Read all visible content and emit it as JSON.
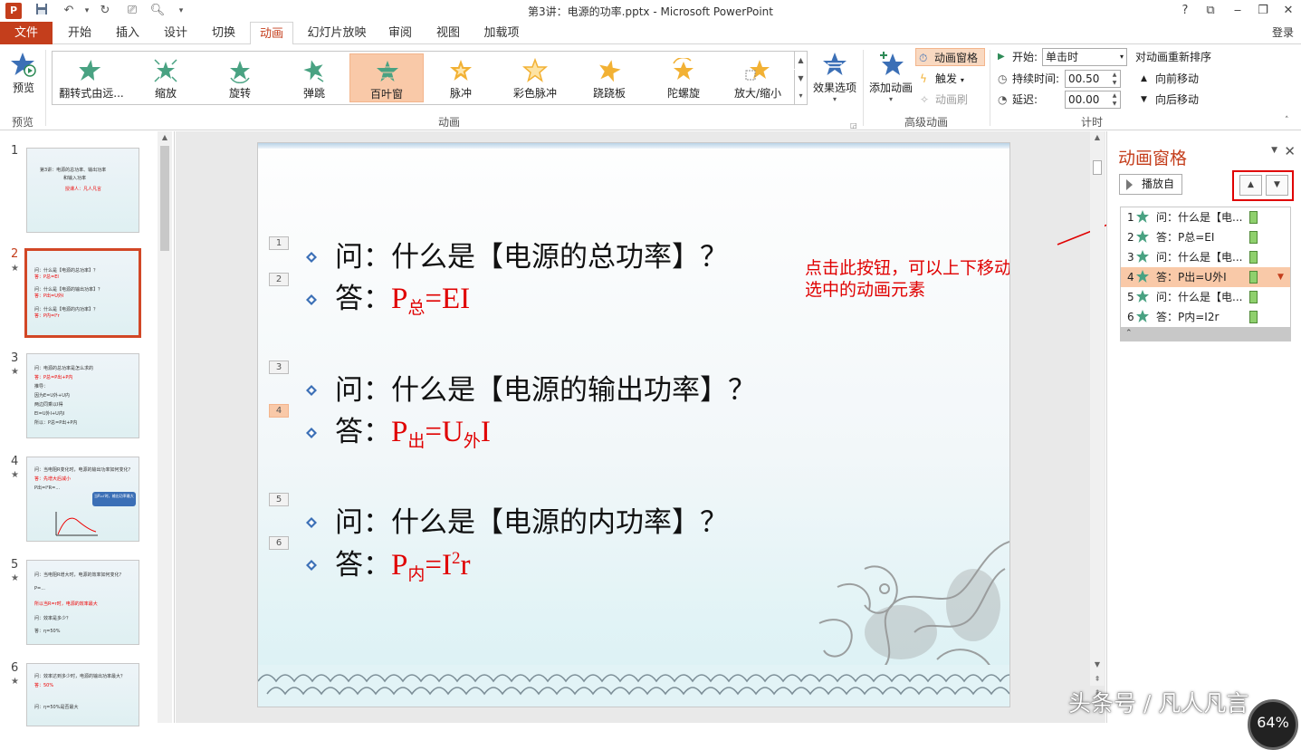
{
  "window": {
    "title": "第3讲：电源的功率.pptx - Microsoft PowerPoint",
    "help": "?",
    "signin": "登录"
  },
  "tabs": [
    "文件",
    "开始",
    "插入",
    "设计",
    "切换",
    "动画",
    "幻灯片放映",
    "审阅",
    "视图",
    "加载项"
  ],
  "active_tab": "动画",
  "ribbon": {
    "preview_label": "预览",
    "preview_group": "预览",
    "gallery": [
      "翻转式由远...",
      "缩放",
      "旋转",
      "弹跳",
      "百叶窗",
      "脉冲",
      "彩色脉冲",
      "跷跷板",
      "陀螺旋",
      "放大/缩小"
    ],
    "gallery_selected": "百叶窗",
    "effect_options": "效果选项",
    "animation_group": "动画",
    "add_animation": "添加动画",
    "animation_pane_btn": "动画窗格",
    "trigger": "触发",
    "painter": "动画刷",
    "advanced_group": "高级动画",
    "start_label": "开始:",
    "start_value": "单击时",
    "duration_label": "持续时间:",
    "duration_value": "00.50",
    "delay_label": "延迟:",
    "delay_value": "00.00",
    "timing_group": "计时",
    "reorder_title": "对动画重新排序",
    "move_earlier": "向前移动",
    "move_later": "向后移动"
  },
  "thumbnails": {
    "numbers": [
      "1",
      "2",
      "3",
      "4",
      "5",
      "6"
    ],
    "selected": "2",
    "slide1": {
      "title": "第3讲：电源的总功率、输出功率",
      "title2": "和输入功率",
      "sub": "授课人：凡人凡言"
    },
    "slide2": [
      "问：什么是【电源的总功率】？",
      "答：P总=EI",
      "问：什么是【电源的输出功率】？",
      "答：P出=U外I",
      "问：什么是【电源的内功率】？",
      "答：P内=I²r"
    ],
    "slide3": [
      "问：电源的总功率是怎么求的",
      "答：P总=P出+P内",
      "推导：",
      "因为E=U外+U内",
      "两边同乘以I得",
      "EI=U外I+U内I",
      "所以：P总=P出+P内"
    ],
    "slide4": [
      "问：当电阻R变化时，电源的输出功率如何变化？",
      "答：先增大后减小",
      "P出=I²R=...",
      "当R=r时，输出功率最大"
    ],
    "slide5": [
      "问：当电阻R增大时，电源的效率如何变化？",
      "P=...",
      "所以当R=r时，电源的效率最大",
      "问：效率是多少？",
      "答：η=50%"
    ],
    "slide6": [
      "问：效率达到多少时，电源的输出功率最大？",
      "答：50%",
      "问：η=50%是否最大"
    ]
  },
  "slide": {
    "tags": [
      "1",
      "2",
      "3",
      "4",
      "5",
      "6"
    ],
    "selected_tag": "4",
    "q1": "问：什么是【电源的总功率】？",
    "a1_prefix": "答：",
    "a1_p": "P",
    "a1_sub": "总",
    "a1_rest": "=EI",
    "q2": "问：什么是【电源的输出功率】？",
    "a2_prefix": "答：",
    "a2_p": "P",
    "a2_sub": "出",
    "a2_mid": "=U",
    "a2_sub2": "外",
    "a2_rest": "I",
    "q3": "问：什么是【电源的内功率】？",
    "a3_prefix": "答：",
    "a3_p": "P",
    "a3_sub": "内",
    "a3_mid": "=I",
    "a3_sup": "2",
    "a3_rest": "r",
    "annotation_line1": "点击此按钮，可以上下移动",
    "annotation_line2": "选中的动画元素"
  },
  "anim_pane": {
    "title": "动画窗格",
    "play_from": "播放自",
    "items": [
      {
        "num": "1",
        "text": "问：什么是【电..."
      },
      {
        "num": "2",
        "text": "答：P总=EI"
      },
      {
        "num": "3",
        "text": "问：什么是【电..."
      },
      {
        "num": "4",
        "text": "答：P出=U外I"
      },
      {
        "num": "5",
        "text": "问：什么是【电..."
      },
      {
        "num": "6",
        "text": "答：P内=I2r"
      }
    ],
    "selected_item": "4"
  },
  "overlay": {
    "watermark": "头条号 / 凡人凡言",
    "zoom": "64%"
  },
  "colors": {
    "accent": "#c43e1c",
    "selection": "#f9c9a8",
    "annotation_red": "#e00000"
  }
}
